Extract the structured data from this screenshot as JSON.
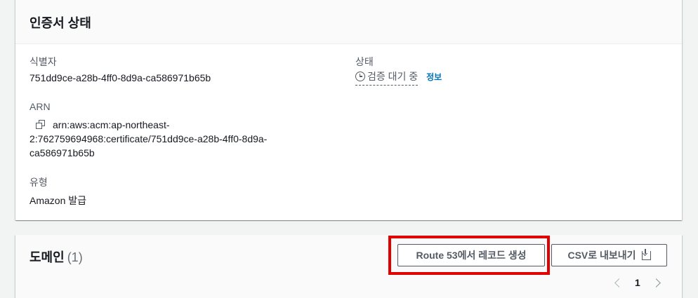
{
  "certificate_status": {
    "title": "인증서 상태",
    "identifier_label": "식별자",
    "identifier_value": "751dd9ce-a28b-4ff0-8d9a-ca586971b65b",
    "status_label": "상태",
    "status_value": "검증 대기 중",
    "info_link": "정보",
    "arn_label": "ARN",
    "arn_line1": "arn:aws:acm:ap-northeast-",
    "arn_line2": "2:762759694968:certificate/751dd9ce-a28b-4ff0-8d9a-",
    "arn_line3": "ca586971b65b",
    "type_label": "유형",
    "type_value": "Amazon 발급"
  },
  "domains": {
    "title": "도메인",
    "count": "(1)",
    "route53_button": "Route 53에서 레코드 생성",
    "csv_button": "CSV로 내보내기",
    "current_page": "1"
  },
  "colors": {
    "highlight": "#e00000",
    "link": "#0073bb"
  },
  "icons": [
    "clock-icon",
    "copy-icon",
    "download-icon",
    "chevron-left-icon",
    "chevron-right-icon"
  ]
}
